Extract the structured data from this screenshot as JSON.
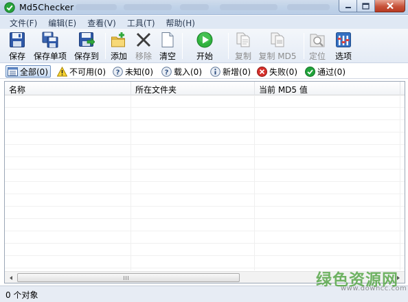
{
  "window": {
    "title": "Md5Checker"
  },
  "menu": [
    "文件(F)",
    "编辑(E)",
    "查看(V)",
    "工具(T)",
    "帮助(H)"
  ],
  "toolbar": {
    "save": "保存",
    "save_item": "保存单项",
    "save_to": "保存到",
    "add": "添加",
    "remove": "移除",
    "clear": "清空",
    "start": "开始",
    "copy": "复制",
    "copy_md5": "复制 MD5",
    "locate": "定位",
    "options": "选项"
  },
  "filters": [
    {
      "label": "全部(0)",
      "icon": "list-icon"
    },
    {
      "label": "不可用(0)",
      "icon": "warning-icon"
    },
    {
      "label": "未知(0)",
      "icon": "unknown-icon"
    },
    {
      "label": "载入(0)",
      "icon": "loaded-icon"
    },
    {
      "label": "新增(0)",
      "icon": "info-icon"
    },
    {
      "label": "失败(0)",
      "icon": "failed-icon"
    },
    {
      "label": "通过(0)",
      "icon": "passed-icon"
    }
  ],
  "columns": [
    "名称",
    "所在文件夹",
    "当前 MD5 值"
  ],
  "status": "0 个对象",
  "watermark": {
    "cn": "绿色资源网",
    "url": "www.downcc.com"
  },
  "colors": {
    "accent": "#2f7fd6",
    "pass": "#20a33a",
    "fail": "#d6302b",
    "watermark": "#58a84a"
  }
}
